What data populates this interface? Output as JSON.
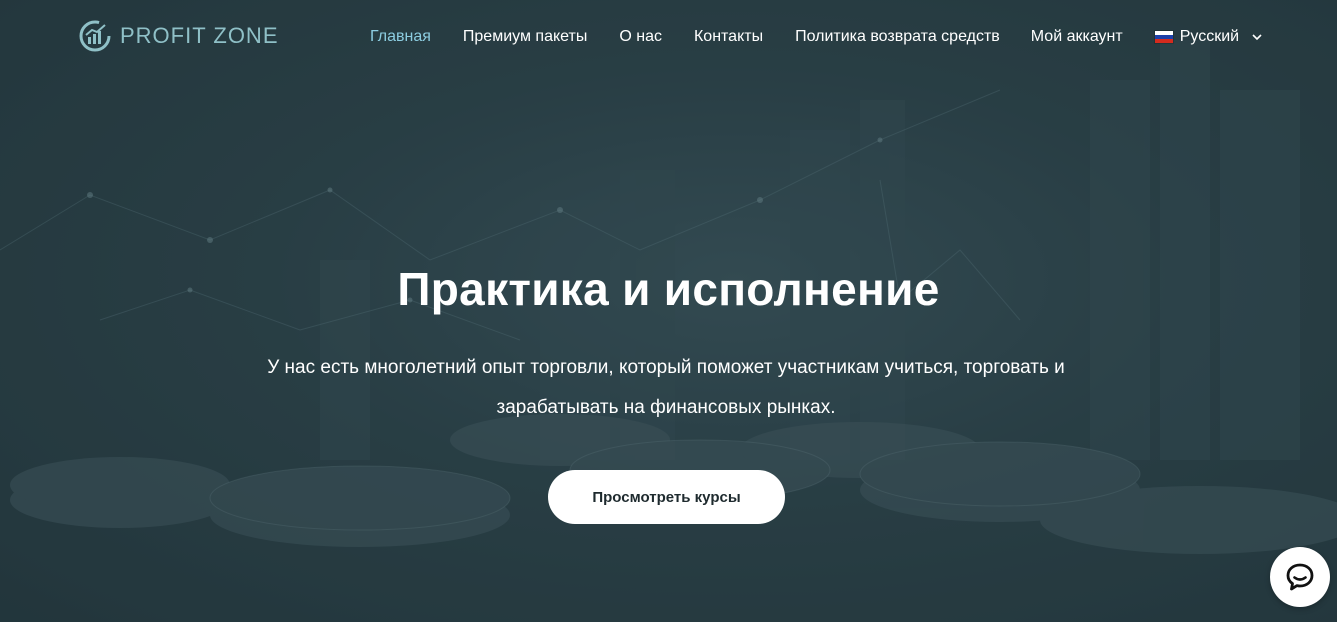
{
  "brand": {
    "name": "PROFIT ZONE",
    "logo_icon": "chart-circle-logo-icon",
    "accent": "#8fc0c7"
  },
  "nav": {
    "items": [
      {
        "label": "Главная",
        "active": true
      },
      {
        "label": "Премиум пакеты",
        "active": false
      },
      {
        "label": "О нас",
        "active": false
      },
      {
        "label": "Контакты",
        "active": false
      },
      {
        "label": "Политика возврата средств",
        "active": false
      },
      {
        "label": "Мой аккаунт",
        "active": false
      }
    ],
    "language": {
      "label": "Русский",
      "flag_icon": "russia-flag-icon",
      "chevron_icon": "chevron-down-icon"
    },
    "active_color": "#8ccde0"
  },
  "hero": {
    "title": "Практика и исполнение",
    "subtitle": "У нас есть многолетний опыт торговли, который поможет участникам учиться, торговать и зарабатывать на финансовых рынках.",
    "cta_label": "Просмотреть курсы"
  },
  "chat_widget": {
    "icon": "chat-bubble-icon"
  },
  "colors": {
    "background": "#2f454c",
    "text": "#ffffff",
    "button_bg": "#ffffff",
    "button_text": "#1e2a2e"
  }
}
